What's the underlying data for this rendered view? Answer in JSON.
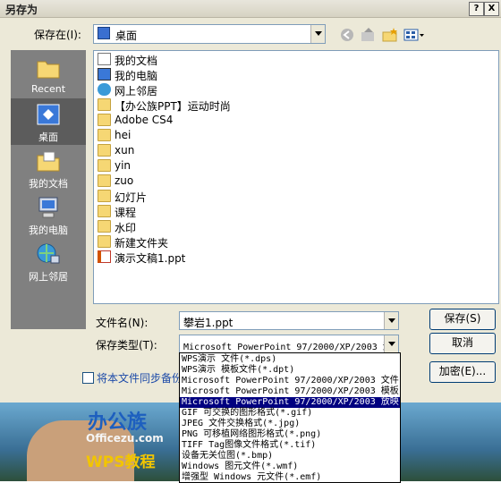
{
  "dialog": {
    "title": "另存为",
    "help_btn": "?",
    "close_btn": "X",
    "save_in_label": "保存在(I):",
    "save_in_value": "桌面",
    "places": [
      {
        "label": "Recent",
        "icon": "recent-folder-icon"
      },
      {
        "label": "桌面",
        "icon": "desktop-icon"
      },
      {
        "label": "我的文档",
        "icon": "my-documents-icon"
      },
      {
        "label": "我的电脑",
        "icon": "my-computer-icon"
      },
      {
        "label": "网上邻居",
        "icon": "network-places-icon"
      }
    ],
    "files": [
      {
        "name": "我的文档",
        "icon": "my-documents-icon"
      },
      {
        "name": "我的电脑",
        "icon": "my-computer-icon"
      },
      {
        "name": "网上邻居",
        "icon": "network-places-icon"
      },
      {
        "name": "【办公族PPT】运动时尚",
        "icon": "folder-icon"
      },
      {
        "name": "Adobe CS4",
        "icon": "folder-icon"
      },
      {
        "name": "hei",
        "icon": "folder-icon"
      },
      {
        "name": "xun",
        "icon": "folder-icon"
      },
      {
        "name": "yin",
        "icon": "folder-icon"
      },
      {
        "name": "zuo",
        "icon": "folder-icon"
      },
      {
        "name": "幻灯片",
        "icon": "folder-icon"
      },
      {
        "name": "课程",
        "icon": "folder-icon"
      },
      {
        "name": "水印",
        "icon": "folder-icon"
      },
      {
        "name": "新建文件夹",
        "icon": "folder-icon"
      },
      {
        "name": "演示文稿1.ppt",
        "icon": "ppt-file-icon"
      }
    ],
    "filename_label": "文件名(N):",
    "filename_value": "攀岩1.ppt",
    "filetype_label": "保存类型(T):",
    "filetype_value": "Microsoft PowerPoint 97/2000/XP/2003 演",
    "sync_checkbox_label": "将本文件同步备份",
    "save_button": "保存(S)",
    "cancel_button": "取消",
    "encrypt_button": "加密(E)...",
    "filetype_options": [
      "WPS演示 文件(*.dps)",
      "WPS演示 模板文件(*.dpt)",
      "Microsoft PowerPoint 97/2000/XP/2003 文件",
      "Microsoft PowerPoint 97/2000/XP/2003 模板",
      "Microsoft PowerPoint 97/2000/XP/2003 放映",
      "GIF 可交换的图形格式(*.gif)",
      "JPEG 文件交换格式(*.jpg)",
      "PNG 可移植网络图形格式(*.png)",
      "TIFF Tag图像文件格式(*.tif)",
      "设备无关位图(*.bmp)",
      "Windows 图元文件(*.wmf)",
      "增强型 Windows 元文件(*.emf)"
    ],
    "selected_option_index": 4
  },
  "background": {
    "logo_cn": "办公族",
    "logo_en": "Officezu.com",
    "logo_wps": "WPS教程"
  },
  "colors": {
    "dialog_bg": "#ece9d8",
    "places_bg": "#808080",
    "selection": "#000080"
  }
}
